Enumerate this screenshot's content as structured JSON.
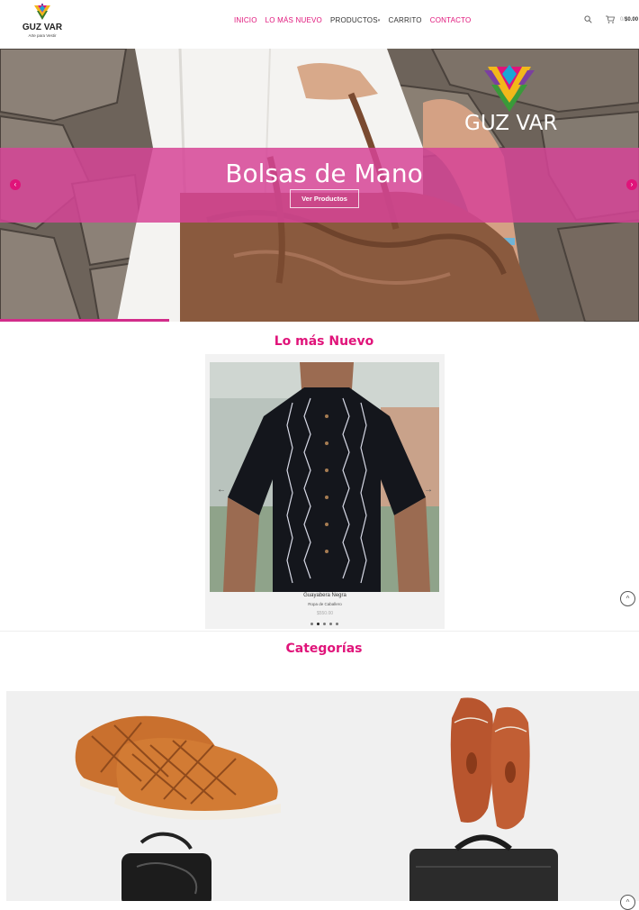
{
  "brand": {
    "name": "GUZ VAR",
    "tagline": "Arte para Vestir"
  },
  "nav": {
    "items": [
      {
        "label": "INICIO"
      },
      {
        "label": "LO MÁS NUEVO"
      },
      {
        "label": "PRODUCTOS"
      },
      {
        "label": "CARRITO"
      },
      {
        "label": "CONTACTO"
      }
    ]
  },
  "cart": {
    "count": "0/",
    "total": "$0.00"
  },
  "hero": {
    "title": "Bolsas de Mano",
    "button": "Ver Productos",
    "logo_text": "GUZ VAR"
  },
  "newest": {
    "title": "Lo más Nuevo",
    "product": {
      "name": "Guayabera Negra",
      "category": "Ropa de Caballero",
      "price": "$550.00"
    }
  },
  "categories": {
    "title": "Categorías"
  },
  "colors": {
    "accent": "#e0147a",
    "band": "#d64496"
  },
  "icons": [
    "search-icon",
    "cart-icon",
    "chevron-left-icon",
    "chevron-right-icon",
    "arrow-up-icon"
  ]
}
